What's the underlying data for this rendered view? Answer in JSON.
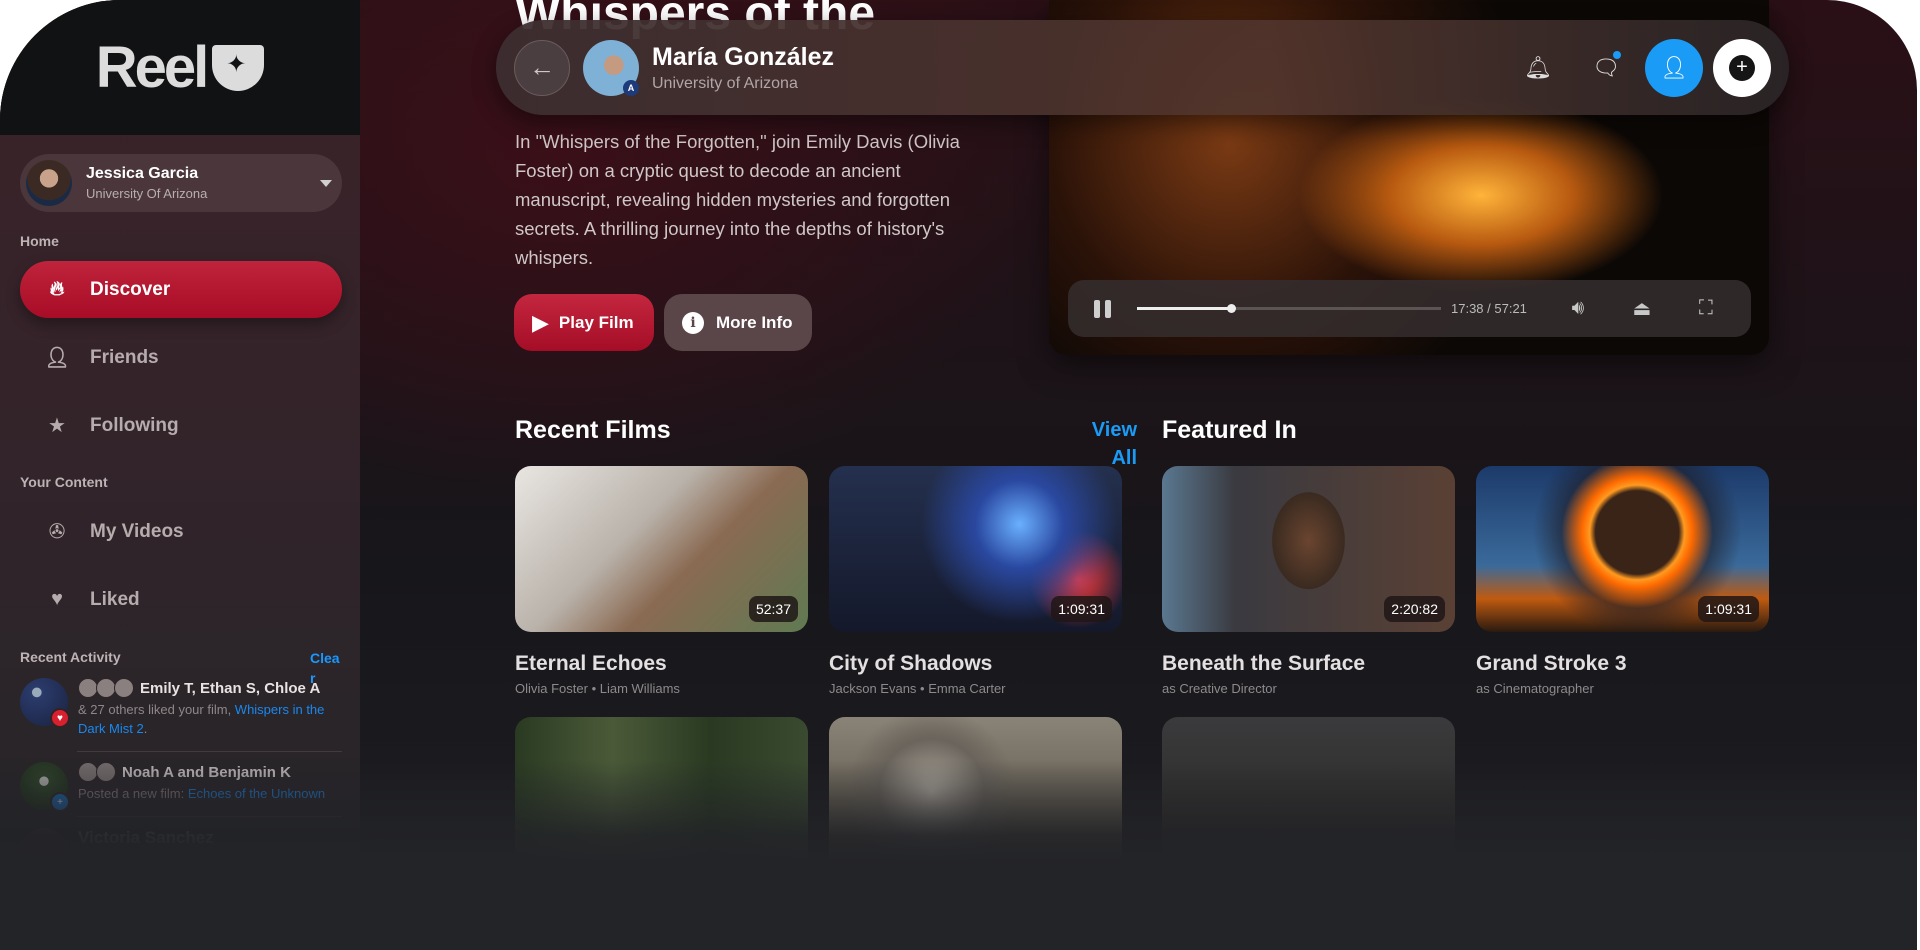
{
  "brand": {
    "logo": "Reel"
  },
  "sidebar": {
    "profile": {
      "name": "Jessica Garcia",
      "subtitle": "University Of Arizona"
    },
    "sections": {
      "home": "Home",
      "content": "Your Content",
      "activity": "Recent Activity"
    },
    "nav": [
      {
        "label": "Discover",
        "icon": "flame-icon",
        "active": true
      },
      {
        "label": "Friends",
        "icon": "friends-icon"
      },
      {
        "label": "Following",
        "icon": "star-icon"
      },
      {
        "label": "My Videos",
        "icon": "film-reel-icon"
      },
      {
        "label": "Liked",
        "icon": "heart-icon"
      }
    ],
    "clear_label": "Clear",
    "activity": [
      {
        "names": "Emily T, Ethan S, Chloe A",
        "text": "& 27 others liked your film, ",
        "link": "Whispers in the Dark Mist 2",
        "suffix": ".",
        "badge": "heart-icon"
      },
      {
        "names": "Noah A and Benjamin K",
        "text": "Posted a new film: ",
        "link": "Echoes of the Unknown",
        "suffix": "",
        "badge": "plus-icon"
      },
      {
        "names": "Victoria Sanchez"
      }
    ]
  },
  "header": {
    "name": "María González",
    "subtitle": "University of Arizona",
    "badge": "A"
  },
  "hero": {
    "title": "Whispers of the",
    "description": "In \"Whispers of the Forgotten,\" join Emily Davis (Olivia Foster) on a cryptic quest to decode an ancient manuscript, revealing hidden mysteries and forgotten secrets. A thrilling journey into the depths of history's whispers.",
    "play_label": "Play Film",
    "more_label": "More Info"
  },
  "player": {
    "time": "17:38 / 57:21",
    "progress": 0.31
  },
  "recent": {
    "heading": "Recent Films",
    "view_all": "View All",
    "films": [
      {
        "title": "Eternal Echoes",
        "subtitle": "Olivia Foster • Liam Williams",
        "duration": "52:37"
      },
      {
        "title": "City of Shadows",
        "subtitle": "Jackson Evans • Emma Carter",
        "duration": "1:09:31"
      }
    ]
  },
  "featured": {
    "heading": "Featured In",
    "films": [
      {
        "title": "Beneath the Surface",
        "subtitle": "as Creative Director",
        "duration": "2:20:82"
      },
      {
        "title": "Grand Stroke 3",
        "subtitle": "as Cinematographer",
        "duration": "1:09:31"
      }
    ]
  },
  "colors": {
    "accent": "#b3152e",
    "link": "#1a9bf5"
  }
}
